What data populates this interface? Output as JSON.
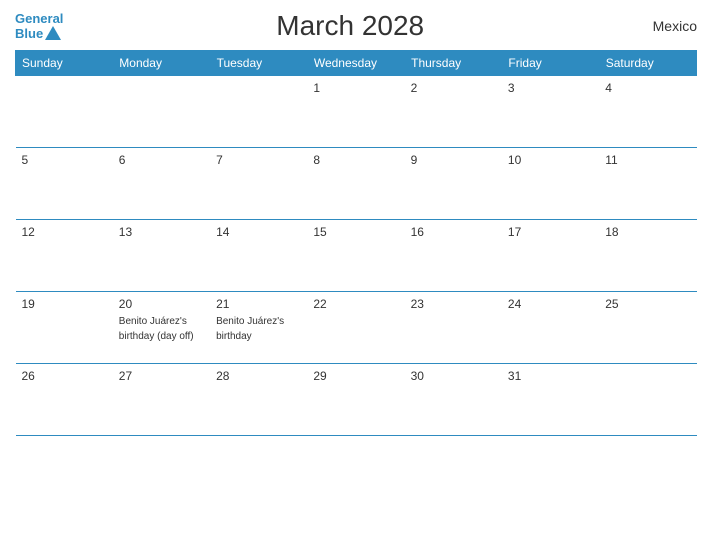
{
  "logo": {
    "text_general": "General",
    "text_blue": "Blue"
  },
  "title": "March 2028",
  "country": "Mexico",
  "header": {
    "days": [
      "Sunday",
      "Monday",
      "Tuesday",
      "Wednesday",
      "Thursday",
      "Friday",
      "Saturday"
    ]
  },
  "weeks": [
    [
      {
        "num": "",
        "event": ""
      },
      {
        "num": "",
        "event": ""
      },
      {
        "num": "",
        "event": ""
      },
      {
        "num": "1",
        "event": ""
      },
      {
        "num": "2",
        "event": ""
      },
      {
        "num": "3",
        "event": ""
      },
      {
        "num": "4",
        "event": ""
      }
    ],
    [
      {
        "num": "5",
        "event": ""
      },
      {
        "num": "6",
        "event": ""
      },
      {
        "num": "7",
        "event": ""
      },
      {
        "num": "8",
        "event": ""
      },
      {
        "num": "9",
        "event": ""
      },
      {
        "num": "10",
        "event": ""
      },
      {
        "num": "11",
        "event": ""
      }
    ],
    [
      {
        "num": "12",
        "event": ""
      },
      {
        "num": "13",
        "event": ""
      },
      {
        "num": "14",
        "event": ""
      },
      {
        "num": "15",
        "event": ""
      },
      {
        "num": "16",
        "event": ""
      },
      {
        "num": "17",
        "event": ""
      },
      {
        "num": "18",
        "event": ""
      }
    ],
    [
      {
        "num": "19",
        "event": ""
      },
      {
        "num": "20",
        "event": "Benito Juárez's birthday (day off)"
      },
      {
        "num": "21",
        "event": "Benito Juárez's birthday"
      },
      {
        "num": "22",
        "event": ""
      },
      {
        "num": "23",
        "event": ""
      },
      {
        "num": "24",
        "event": ""
      },
      {
        "num": "25",
        "event": ""
      }
    ],
    [
      {
        "num": "26",
        "event": ""
      },
      {
        "num": "27",
        "event": ""
      },
      {
        "num": "28",
        "event": ""
      },
      {
        "num": "29",
        "event": ""
      },
      {
        "num": "30",
        "event": ""
      },
      {
        "num": "31",
        "event": ""
      },
      {
        "num": "",
        "event": ""
      }
    ]
  ]
}
